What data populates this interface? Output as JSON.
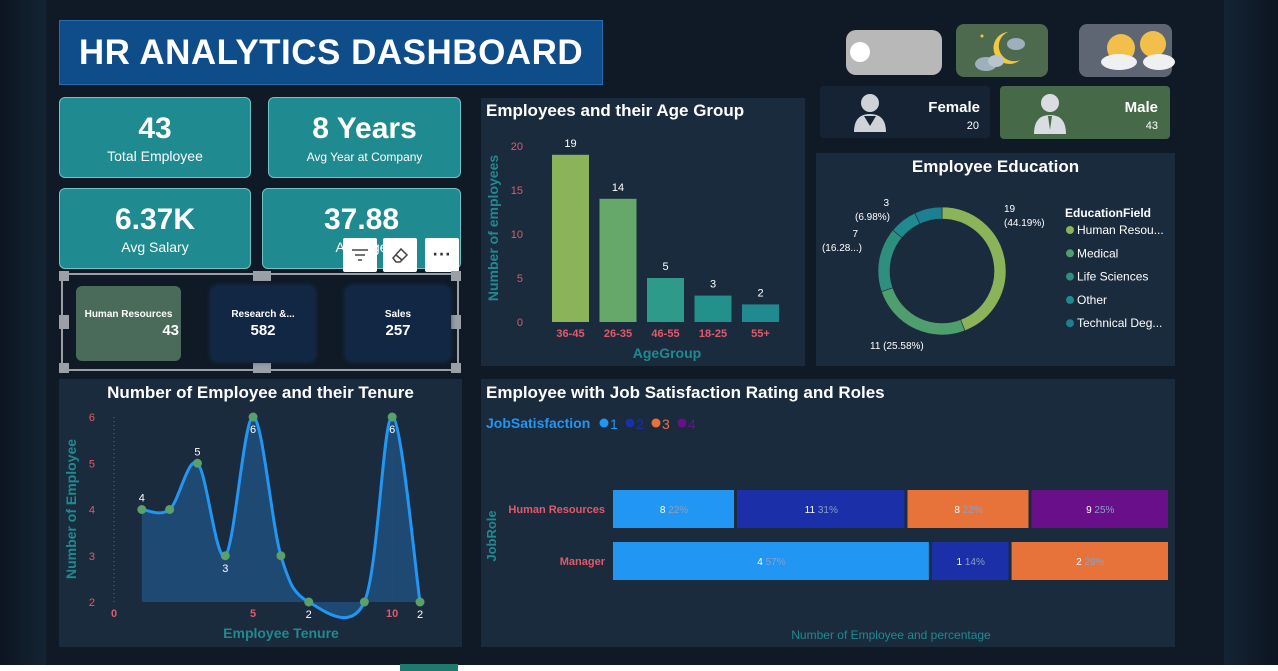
{
  "dashboard_title": "HR ANALYTICS DASHBOARD",
  "kpis": {
    "total_employee": {
      "value": "43",
      "label": "Total Employee"
    },
    "avg_year": {
      "value": "8 Years",
      "label": "Avg Year at Company"
    },
    "avg_salary": {
      "value": "6.37K",
      "label": "Avg Salary"
    },
    "avg_age": {
      "value": "37.88",
      "label": "Avg Age"
    }
  },
  "departments": [
    {
      "name": "Human Resources",
      "value": "43"
    },
    {
      "name": "Research &...",
      "value": "582"
    },
    {
      "name": "Sales",
      "value": "257"
    }
  ],
  "toolbar": {
    "filter_icon": "filter-icon",
    "eraser_icon": "eraser-icon",
    "more_label": "···"
  },
  "gender": {
    "female": {
      "label": "Female",
      "count": "20"
    },
    "male": {
      "label": "Male",
      "count": "43"
    }
  },
  "theme_icons": {
    "night": "moon-cloud-icon",
    "day": "sun-cloud-icon"
  },
  "colors": {
    "teal": "#1f8a8f",
    "bar_green": "#8bb35a",
    "js1": "#2196f3",
    "js2": "#1a2fa8",
    "js3": "#e8733a",
    "js4": "#6a0f8a",
    "accent_red": "#e05a6a"
  },
  "age_chart": {
    "title": "Employees and their Age Group",
    "xlabel": "AgeGroup",
    "ylabel": "Number of employees"
  },
  "education_chart": {
    "title": "Employee Education",
    "legend_title": "EducationField"
  },
  "tenure_chart": {
    "title": "Number of Employee and their Tenure",
    "xlabel": "Employee Tenure",
    "ylabel": "Number of Employee"
  },
  "satisfaction_chart": {
    "title": "Employee with Job Satisfaction Rating and Roles",
    "legend_title": "JobSatisfaction",
    "ylabel": "JobRole",
    "xlabel": "Number of Employee and percentage"
  },
  "chart_data": [
    {
      "type": "bar",
      "title": "Employees and their Age Group",
      "xlabel": "AgeGroup",
      "ylabel": "Number of employees",
      "categories": [
        "36-45",
        "26-35",
        "46-55",
        "18-25",
        "55+"
      ],
      "values": [
        19,
        14,
        5,
        3,
        2
      ],
      "ylim": [
        0,
        20
      ],
      "yticks": [
        0,
        5,
        10,
        15,
        20
      ],
      "colors": [
        "#8bb35a",
        "#66a86a",
        "#2e9a8a",
        "#22918c",
        "#1f8a8f"
      ]
    },
    {
      "type": "pie",
      "title": "Employee Education",
      "legend_title": "EducationField",
      "labels": [
        "Human Resou...",
        "Medical",
        "Life Sciences",
        "Other",
        "Technical Deg..."
      ],
      "values": [
        19,
        11,
        7,
        3,
        3
      ],
      "slice_labels": [
        {
          "value": "19",
          "pct": "(44.19%)"
        },
        {
          "value": "11 (25.58%)",
          "pct": ""
        },
        {
          "value": "7",
          "pct": "(16.28...)"
        },
        {
          "value": "3",
          "pct": "(6.98%)"
        },
        {
          "value": "",
          "pct": ""
        }
      ],
      "colors": [
        "#8bb35a",
        "#4f9e6e",
        "#2f8f7e",
        "#1f8a8f",
        "#1c7f92"
      ]
    },
    {
      "type": "area",
      "title": "Number of Employee and their Tenure",
      "xlabel": "Employee Tenure",
      "ylabel": "Number of Employee",
      "x": [
        1,
        2,
        3,
        4,
        5,
        6,
        7,
        9,
        10,
        11
      ],
      "y": [
        4,
        4,
        5,
        3,
        6,
        3,
        2,
        2,
        6,
        2
      ],
      "point_labels": [
        "4",
        "",
        "5",
        "3",
        "6",
        "",
        "2",
        "",
        "6",
        "2"
      ],
      "xticks": [
        0,
        5,
        10
      ],
      "yticks": [
        2,
        3,
        4,
        5,
        6
      ],
      "xlim": [
        0,
        11
      ],
      "ylim": [
        2,
        6
      ]
    },
    {
      "type": "bar",
      "orientation": "horizontal-stacked-100",
      "title": "Employee with Job Satisfaction Rating and Roles",
      "legend_title": "JobSatisfaction",
      "ylabel": "JobRole",
      "xlabel": "Number of Employee and percentage",
      "categories": [
        "Human Resources",
        "Manager"
      ],
      "series": [
        {
          "name": "1",
          "values": [
            8,
            4
          ],
          "pct": [
            "22%",
            "57%"
          ],
          "color": "#2196f3"
        },
        {
          "name": "2",
          "values": [
            11,
            1
          ],
          "pct": [
            "31%",
            "14%"
          ],
          "color": "#1a2fa8"
        },
        {
          "name": "3",
          "values": [
            8,
            2
          ],
          "pct": [
            "22%",
            "29%"
          ],
          "color": "#e8733a"
        },
        {
          "name": "4",
          "values": [
            9,
            0
          ],
          "pct": [
            "25%",
            ""
          ],
          "color": "#6a0f8a"
        }
      ]
    }
  ]
}
